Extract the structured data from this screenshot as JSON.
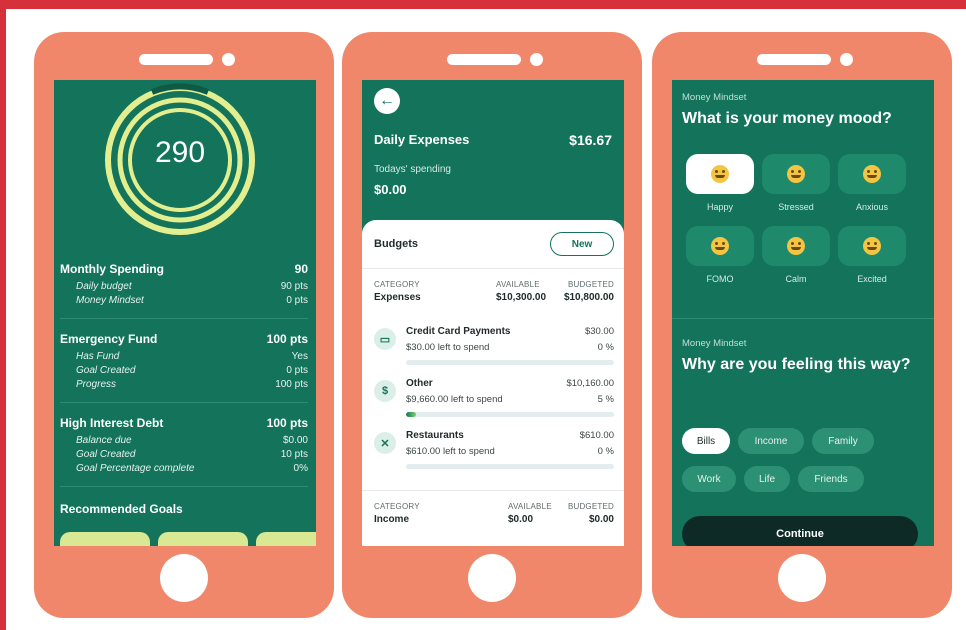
{
  "phone1": {
    "score": "290",
    "sections": [
      {
        "title": "Monthly Spending",
        "value": "90",
        "items": [
          {
            "label": "Daily budget",
            "value": "90 pts"
          },
          {
            "label": "Money Mindset",
            "value": "0 pts"
          }
        ]
      },
      {
        "title": "Emergency Fund",
        "value": "100 pts",
        "items": [
          {
            "label": "Has Fund",
            "value": "Yes"
          },
          {
            "label": "Goal Created",
            "value": "0 pts"
          },
          {
            "label": "Progress",
            "value": "100 pts"
          }
        ]
      },
      {
        "title": "High Interest Debt",
        "value": "100 pts",
        "items": [
          {
            "label": "Balance due",
            "value": "$0.00"
          },
          {
            "label": "Goal Created",
            "value": "10 pts"
          },
          {
            "label": "Goal Percentage complete",
            "value": "0%"
          }
        ]
      }
    ],
    "recommended_title": "Recommended Goals"
  },
  "phone2": {
    "back_icon": "arrow-left-icon",
    "title": "Daily Expenses",
    "amount": "$16.67",
    "today_label": "Todays' spending",
    "today_value": "$0.00",
    "budgets_label": "Budgets",
    "new_label": "New",
    "header_category": "CATEGORY",
    "header_available": "AVAILABLE",
    "header_budgeted": "BUDGETED",
    "expenses": {
      "category": "Expenses",
      "available": "$10,300.00",
      "budgeted": "$10,800.00"
    },
    "items": [
      {
        "icon": "credit-card-icon",
        "glyph": "▭",
        "name": "Credit Card Payments",
        "left": "$30.00 left to spend",
        "amount": "$30.00",
        "pct": "0 %",
        "progress": 0
      },
      {
        "icon": "dollar-icon",
        "glyph": "$",
        "name": "Other",
        "left": "$9,660.00 left to spend",
        "amount": "$10,160.00",
        "pct": "5 %",
        "progress": 0.05
      },
      {
        "icon": "fork-knife-icon",
        "glyph": "✕",
        "name": "Restaurants",
        "left": "$610.00 left to spend",
        "amount": "$610.00",
        "pct": "0 %",
        "progress": 0
      }
    ],
    "income": {
      "category": "Income",
      "available": "$0.00",
      "budgeted": "$0.00"
    }
  },
  "phone3": {
    "mindset_label": "Money Mindset",
    "question1": "What is your money mood?",
    "moods": [
      "Happy",
      "Stressed",
      "Anxious",
      "FOMO",
      "Calm",
      "Excited"
    ],
    "selected_mood": "Happy",
    "mindset_label2": "Money Mindset",
    "question2": "Why are you feeling this way?",
    "chips_row1": [
      "Bills",
      "Income",
      "Family"
    ],
    "chips_row2": [
      "Work",
      "Life",
      "Friends"
    ],
    "selected_chip": "Bills",
    "continue_label": "Continue"
  },
  "colors": {
    "frame": "#d6303a",
    "phone": "#f0876a",
    "screen": "#13735b",
    "ring": "#e3ef8f",
    "rec_card": "#d9e993"
  }
}
